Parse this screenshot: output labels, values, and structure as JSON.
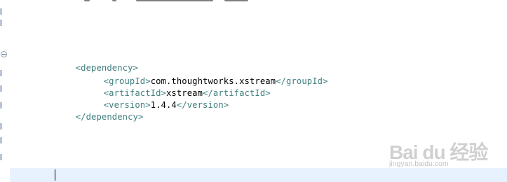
{
  "editor": {
    "lines": [
      {
        "tag_open": "<dependency>",
        "text": "",
        "tag_close": ""
      },
      {
        "tag_open": "<groupId>",
        "text": "com.thoughtworks.xstream",
        "tag_close": "</groupId>"
      },
      {
        "tag_open": "<artifactId>",
        "text": "xstream",
        "tag_close": "</artifactId>"
      },
      {
        "tag_open": "<version>",
        "text": "1.4.4",
        "tag_close": "</version>"
      },
      {
        "tag_open": "</dependency>",
        "text": "",
        "tag_close": ""
      }
    ],
    "colors": {
      "tag": "#3f7f7f",
      "text": "#000000",
      "current_line": "#e8f2fe"
    }
  },
  "watermark": {
    "main": "Bai du 经验",
    "sub": "jingyan.baidu.com"
  }
}
